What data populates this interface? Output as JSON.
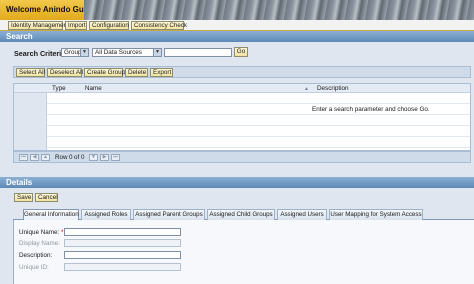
{
  "header": {
    "title": "Welcome Anindo Gupta"
  },
  "nav": {
    "items": [
      "Identity Management",
      "Import",
      "Configuration",
      "Consistency Check"
    ]
  },
  "search": {
    "section_title": "Search",
    "criteria_label": "Search Criteria",
    "type_select": "Group",
    "source_select": "All Data Sources",
    "query_value": "",
    "go_label": "Go"
  },
  "toolbar": {
    "select_all": "Select All",
    "deselect_all": "Deselect All",
    "create_group": "Create Group",
    "delete": "Delete",
    "export": "Export"
  },
  "results": {
    "columns": [
      "Type",
      "Name",
      "Description"
    ],
    "sort_indicator": "▲",
    "empty_message": "Enter a search parameter and choose Go."
  },
  "pager": {
    "row_label": "Row",
    "current_row": "0",
    "of_label": "of",
    "total_rows": "0"
  },
  "details": {
    "section_title": "Details",
    "save_label": "Save",
    "cancel_label": "Cancel",
    "tabs": [
      "General Information",
      "Assigned Roles",
      "Assigned Parent Groups",
      "Assigned Child Groups",
      "Assigned Users",
      "User Mapping for System Access"
    ],
    "fields": {
      "unique_name": {
        "label": "Unique Name:",
        "required_mark": "*",
        "value": ""
      },
      "display_name": {
        "label": "Display Name:",
        "value": ""
      },
      "description": {
        "label": "Description:",
        "value": ""
      },
      "unique_id": {
        "label": "Unique ID:",
        "value": ""
      }
    }
  }
}
